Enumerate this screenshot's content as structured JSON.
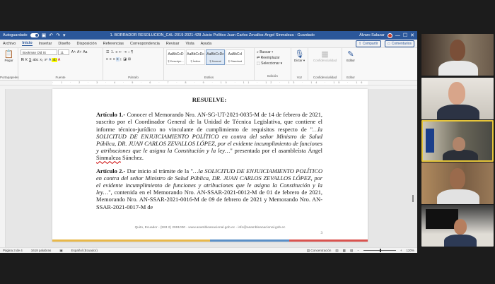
{
  "titlebar": {
    "autosave_label": "Autoguardado",
    "document_title": "1. BORRADOR RESOLUCIÓN_CAL-2019-2021-428 Juicio Político Juan Carlos Zevallos-Ángel Sinmaleza  -  Guardado",
    "user_name": "Álvaro Salazar"
  },
  "menu": {
    "tabs": [
      "Archivo",
      "Inicio",
      "Insertar",
      "Diseño",
      "Disposición",
      "Referencias",
      "Correspondencia",
      "Revisar",
      "Vista",
      "Ayuda"
    ],
    "active_tab": "Inicio",
    "share_label": "Compartir",
    "comments_label": "Comentarios"
  },
  "ribbon": {
    "paste_label": "Pegar",
    "clipboard_label": "Portapapeles",
    "font_name": "Bookman Old St",
    "font_size": "11",
    "font_group_label": "Fuente",
    "paragraph_group_label": "Párrafo",
    "styles": [
      {
        "preview": "AaBbCcD",
        "name": "¶ Descripc..."
      },
      {
        "preview": "AaBbCcDc",
        "name": "¶ Índice"
      },
      {
        "preview": "AaBbCcDc",
        "name": "¶ Normal"
      },
      {
        "preview": "AaBbCcI",
        "name": "¶ Standard"
      }
    ],
    "styles_group_label": "Estilos",
    "edit_items": [
      "Buscar",
      "Reemplazar",
      "Seleccionar"
    ],
    "edit_group_label": "Edición",
    "dictate_label": "Dictar",
    "voice_group_label": "Voz",
    "confidentiality_label": "Confidencialidad",
    "confidentiality_group_label": "Confidencialidad",
    "editor_label": "Editor",
    "editor_group_label": "Editor"
  },
  "document": {
    "heading": "RESUELVE:",
    "article1": {
      "label": "Artículo 1.-",
      "text1": " Conocer el Memorando Nro. AN-SG-UT-2021-0035-M de 14 de febrero de 2021, suscrito por el Coordinador General de la Unidad de Técnica Legislativa, que contiene el informe técnico-jurídico no vinculante de cumplimiento de requisitos respecto de \"",
      "italic": "…la SOLICITUD DE ENJUICIAMIENTO POLÍTICO en contra del señor Ministro de Salud Pública, DR. JUAN CARLOS ZEVALLOS LÓPEZ, por el evidente incumplimiento de funciones y atribuciones que le asigna la Constitución y la ley…",
      "text2": "\" presentada por el asambleísta Ángel ",
      "underlined": "Sinmaleza",
      "text3": " Sánchez."
    },
    "article2": {
      "label": "Artículo 2.-",
      "text1": " Dar inicio al trámite de la \"",
      "italic": "…la SOLICITUD DE ENJUICIAMIENTO POLÍTICO en contra del señor Ministro de Salud Pública, DR. JUAN CARLOS ZEVALLOS LÓPEZ, por el evidente incumplimiento de funciones y atribuciones que le asigna la Constitución y la ley…",
      "text2": "\", contenida en el Memorando Nro. AN-SSAR-2021-0012-M de 01 de febrero de 2021, Memorando Nro. AN-SSAR-2021-0016-M de 09 de febrero de 2021 y Memorando Nro. AN-SSAR-2021-0017-M de"
    },
    "footer": "Quito, Ecuador - (593 2) 2991000 - www.asambleanacional.gob.ec - info@asambleanacional.gob.ec",
    "page_number": "3"
  },
  "statusbar": {
    "page": "Página 3 de 4",
    "words": "1618 palabras",
    "language": "Español (Ecuador)",
    "focus": "Concentración",
    "zoom": "120%"
  },
  "colors": {
    "word_blue": "#2b579a",
    "active_speaker_border": "#e6c53a",
    "stripe": [
      "#e8b84a",
      "#e8b84a",
      "#5a8fc7",
      "#d9534f"
    ]
  },
  "participants": [
    {
      "name_icon": "participant-video",
      "active": false
    },
    {
      "name_icon": "participant-video",
      "active": false
    },
    {
      "name_icon": "participant-video",
      "active": true
    },
    {
      "name_icon": "participant-video",
      "active": false
    },
    {
      "name_icon": "participant-video",
      "active": false
    }
  ]
}
